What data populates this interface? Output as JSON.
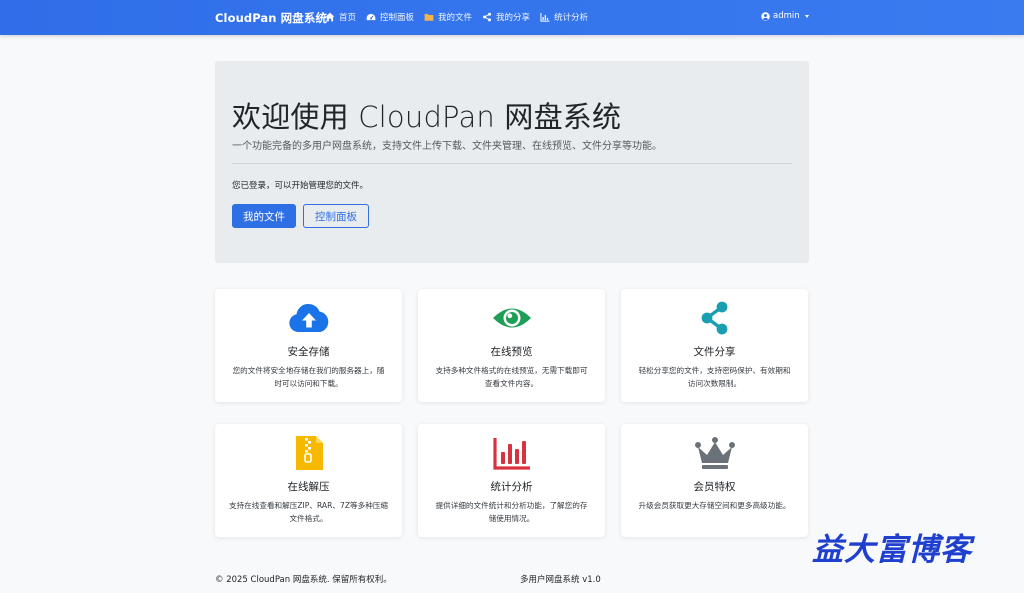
{
  "navbar": {
    "brand": "CloudPan 网盘系统",
    "items": [
      {
        "label": "首页",
        "icon": "home-icon"
      },
      {
        "label": "控制面板",
        "icon": "dashboard-icon"
      },
      {
        "label": "我的文件",
        "icon": "folder-icon"
      },
      {
        "label": "我的分享",
        "icon": "share-icon"
      },
      {
        "label": "统计分析",
        "icon": "chart-icon"
      }
    ],
    "user": "admin"
  },
  "hero": {
    "title": "欢迎使用 CloudPan 网盘系统",
    "lead": "一个功能完备的多用户网盘系统，支持文件上传下载、文件夹管理、在线预览、文件分享等功能。",
    "status": "您已登录，可以开始管理您的文件。",
    "primary_button": "我的文件",
    "secondary_button": "控制面板"
  },
  "features": [
    {
      "title": "安全存储",
      "desc": "您的文件将安全地存储在我们的服务器上，随时可以访问和下载。",
      "icon": "cloud-upload-icon",
      "color": "#1a73e8"
    },
    {
      "title": "在线预览",
      "desc": "支持多种文件格式的在线预览，无需下载即可查看文件内容。",
      "icon": "eye-icon",
      "color": "#1e9e57"
    },
    {
      "title": "文件分享",
      "desc": "轻松分享您的文件，支持密码保护、有效期和访问次数限制。",
      "icon": "share-icon",
      "color": "#1a9fb2"
    },
    {
      "title": "在线解压",
      "desc": "支持在线查看和解压ZIP、RAR、7Z等多种压缩文件格式。",
      "icon": "zip-file-icon",
      "color": "#f6b900"
    },
    {
      "title": "统计分析",
      "desc": "提供详细的文件统计和分析功能，了解您的存储使用情况。",
      "icon": "bar-chart-icon",
      "color": "#d9323f"
    },
    {
      "title": "会员特权",
      "desc": "升级会员获取更大存储空间和更多高级功能。",
      "icon": "crown-icon",
      "color": "#6b7178"
    }
  ],
  "footer": {
    "copyright": "© 2025 CloudPan 网盘系统. 保留所有权利。",
    "version": "多用户网盘系统 v1.0"
  },
  "watermark": "益大富博客"
}
